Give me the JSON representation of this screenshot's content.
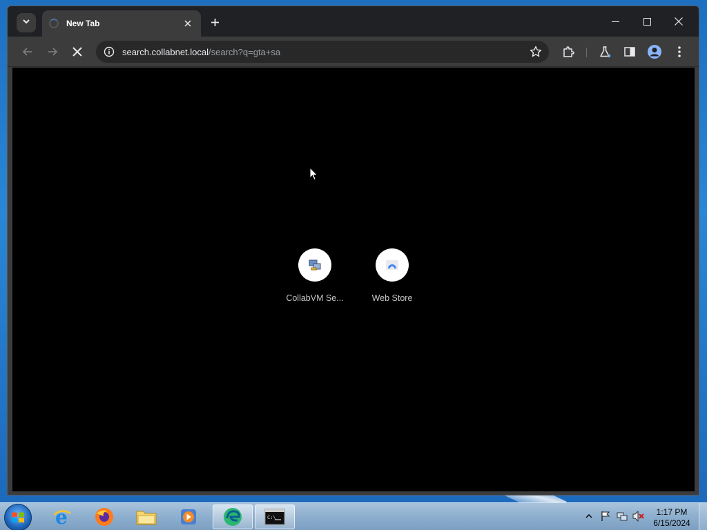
{
  "browser": {
    "tab_title": "New Tab",
    "url_host": "search.collabnet.local",
    "url_path": "/search?q=gta+sa"
  },
  "shortcuts": [
    {
      "label": "CollabVM Se..."
    },
    {
      "label": "Web Store"
    }
  ],
  "taskbar": {
    "time": "1:17 PM",
    "date": "6/15/2024",
    "apps": [
      "internet-explorer",
      "firefox",
      "file-explorer",
      "media-player",
      "edge",
      "command-prompt"
    ]
  },
  "colors": {
    "titlebar": "#202124",
    "toolbar": "#3c3c3c",
    "content_bg": "#000000",
    "accent_blue": "#8ab4f8"
  }
}
